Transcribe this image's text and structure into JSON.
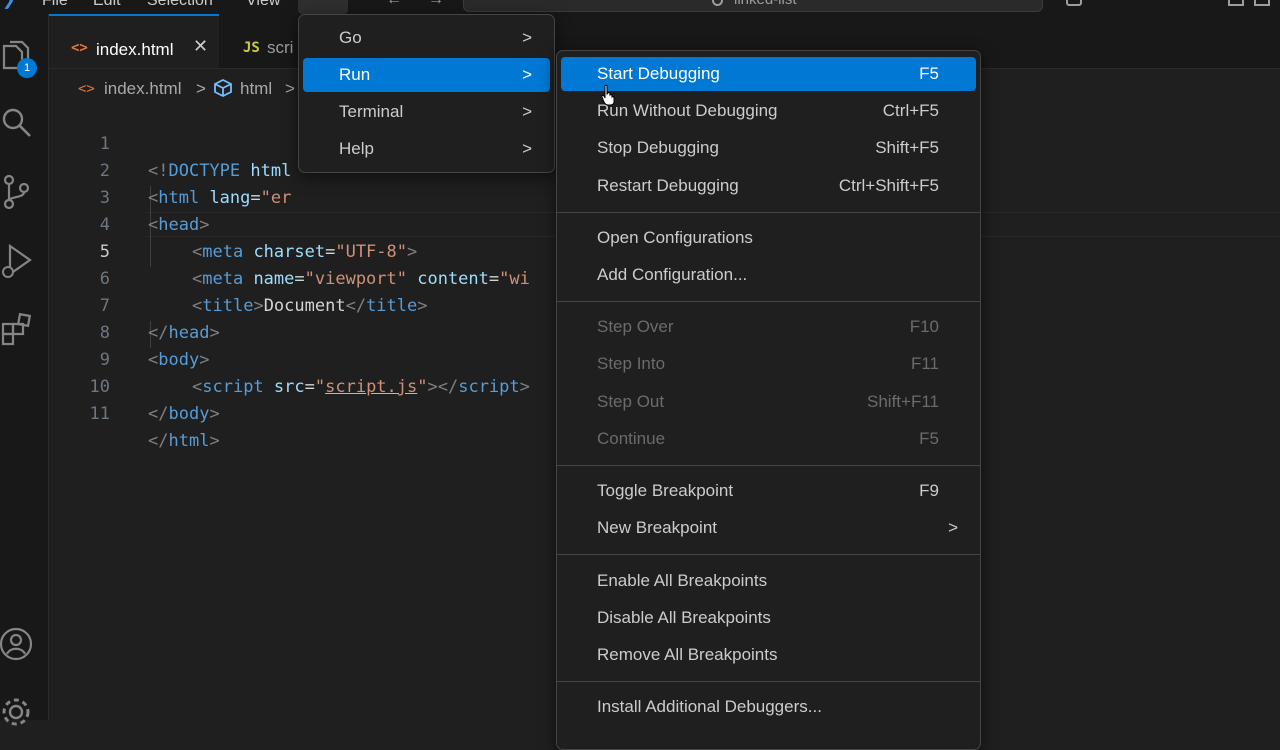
{
  "titlebar": {
    "menus": [
      "File",
      "Edit",
      "Selection",
      "View"
    ],
    "search_text": "linked-list"
  },
  "activity": {
    "explorer_badge": "1"
  },
  "tabs": [
    {
      "icon": "<>",
      "label": "index.html",
      "close": "✕"
    },
    {
      "icon": "JS",
      "label": "scri"
    }
  ],
  "breadcrumb": {
    "file": "index.html",
    "separator": ">",
    "symbol": "html",
    "trail": ">"
  },
  "editor": {
    "current_line": 5,
    "lines": [
      {
        "n": "1"
      },
      {
        "n": "2"
      },
      {
        "n": "3"
      },
      {
        "n": "4"
      },
      {
        "n": "5"
      },
      {
        "n": "6"
      },
      {
        "n": "7"
      },
      {
        "n": "8"
      },
      {
        "n": "9"
      },
      {
        "n": "10"
      },
      {
        "n": "11"
      }
    ],
    "tokens": {
      "l1": [
        "<!",
        "DOCTYPE",
        " html"
      ],
      "l2": [
        "<",
        "html",
        " lang",
        "=",
        "\"er"
      ],
      "l3": [
        "<",
        "head",
        ">"
      ],
      "l4": [
        "<",
        "meta",
        " charset",
        "=",
        "\"UTF-8\"",
        ">"
      ],
      "l5": [
        "<",
        "meta",
        " name",
        "=",
        "\"viewport\"",
        " content",
        "=",
        "\"wi"
      ],
      "l6": [
        "<",
        "title",
        ">",
        "Document",
        "</",
        "title",
        ">"
      ],
      "l7": [
        "</",
        "head",
        ">"
      ],
      "l8": [
        "<",
        "body",
        ">"
      ],
      "l9": [
        "<",
        "script",
        " src",
        "=",
        "\"",
        "script.js",
        "\"",
        "></",
        "script",
        ">"
      ],
      "l10": [
        "</",
        "body",
        ">"
      ],
      "l11": [
        "</",
        "html",
        ">"
      ]
    }
  },
  "menu_main": {
    "items": [
      {
        "label": "Go",
        "arrow": ">"
      },
      {
        "label": "Run",
        "arrow": ">"
      },
      {
        "label": "Terminal",
        "arrow": ">"
      },
      {
        "label": "Help",
        "arrow": ">"
      }
    ]
  },
  "menu_run": {
    "items": [
      {
        "label": "Start Debugging",
        "key": "F5"
      },
      {
        "label": "Run Without Debugging",
        "key": "Ctrl+F5"
      },
      {
        "label": "Stop Debugging",
        "key": "Shift+F5"
      },
      {
        "label": "Restart Debugging",
        "key": "Ctrl+Shift+F5"
      },
      {
        "label": "Open Configurations",
        "key": ""
      },
      {
        "label": "Add Configuration...",
        "key": ""
      },
      {
        "label": "Step Over",
        "key": "F10"
      },
      {
        "label": "Step Into",
        "key": "F11"
      },
      {
        "label": "Step Out",
        "key": "Shift+F11"
      },
      {
        "label": "Continue",
        "key": "F5"
      },
      {
        "label": "Toggle Breakpoint",
        "key": "F9"
      },
      {
        "label": "New Breakpoint",
        "arrow": ">"
      },
      {
        "label": "Enable All Breakpoints",
        "key": ""
      },
      {
        "label": "Disable All Breakpoints",
        "key": ""
      },
      {
        "label": "Remove All Breakpoints",
        "key": ""
      },
      {
        "label": "Install Additional Debuggers...",
        "key": ""
      }
    ]
  },
  "colors": {
    "accent": "#0078d4",
    "tag": "#569cd6",
    "attr": "#9cdcfe",
    "string": "#ce9178"
  }
}
